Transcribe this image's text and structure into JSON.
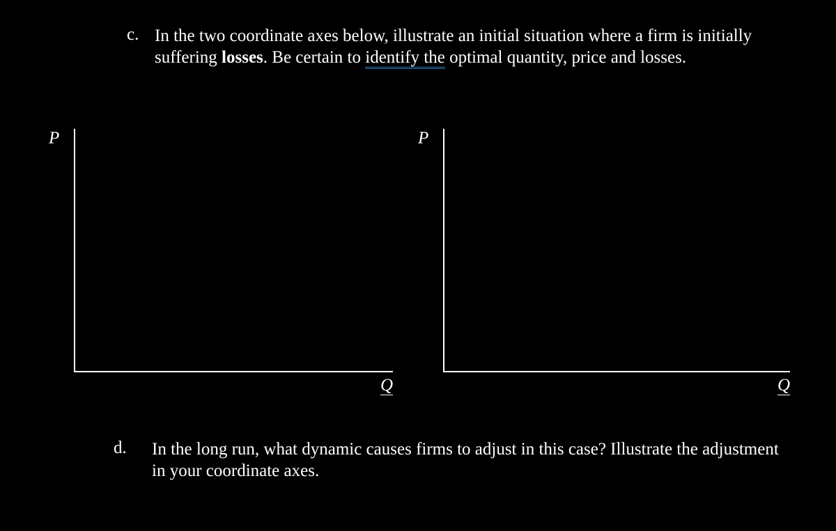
{
  "question_c": {
    "marker": "c.",
    "pre": "In the two coordinate axes below, illustrate an initial situation where a firm is initially suffering ",
    "bold": "losses",
    "mid1": ". Be certain to ",
    "underlined": "identify  the",
    "post": " optimal quantity, price and losses."
  },
  "question_d": {
    "marker": "d.",
    "text": "In the long run, what dynamic causes firms to adjust in this case? Illustrate the adjustment in your coordinate axes."
  },
  "axis": {
    "P": "P",
    "Q": "Q"
  }
}
